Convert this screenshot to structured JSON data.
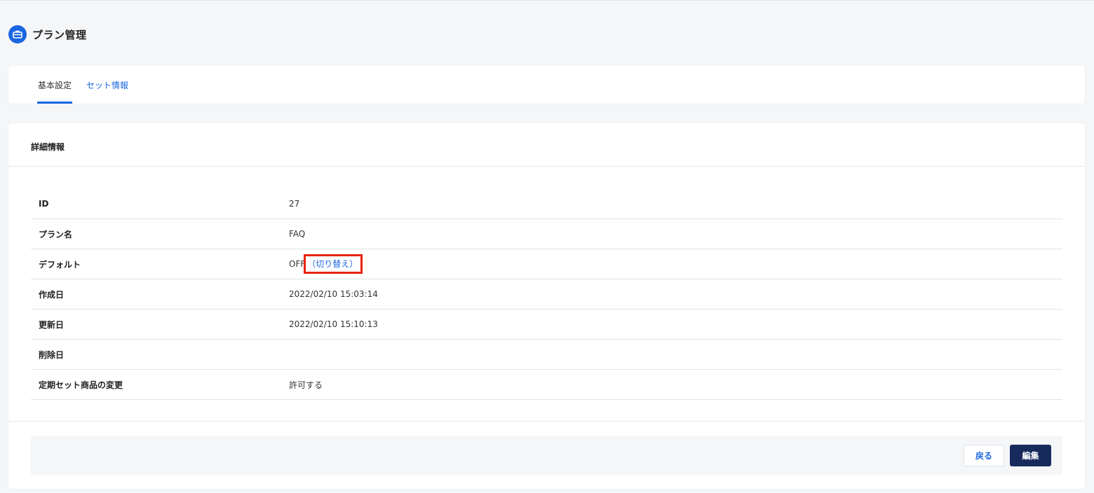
{
  "header": {
    "title": "プラン管理",
    "icon": "briefcase-icon"
  },
  "tabs": [
    {
      "label": "基本設定",
      "active": true
    },
    {
      "label": "セット情報",
      "active": false
    }
  ],
  "detail": {
    "title": "詳細情報",
    "rows": [
      {
        "label": "ID",
        "value": "27"
      },
      {
        "label": "プラン名",
        "value": "FAQ"
      },
      {
        "label": "デフォルト",
        "value": "OFF",
        "link": "（切り替え）"
      },
      {
        "label": "作成日",
        "value": "2022/02/10 15:03:14"
      },
      {
        "label": "更新日",
        "value": "2022/02/10 15:10:13"
      },
      {
        "label": "削除日",
        "value": ""
      },
      {
        "label": "定期セット商品の変更",
        "value": "許可する"
      }
    ]
  },
  "footer": {
    "back_label": "戻る",
    "edit_label": "編集"
  },
  "colors": {
    "accent": "#1a66e0",
    "primary_button": "#162a5c",
    "highlight_box": "#e8250c"
  }
}
